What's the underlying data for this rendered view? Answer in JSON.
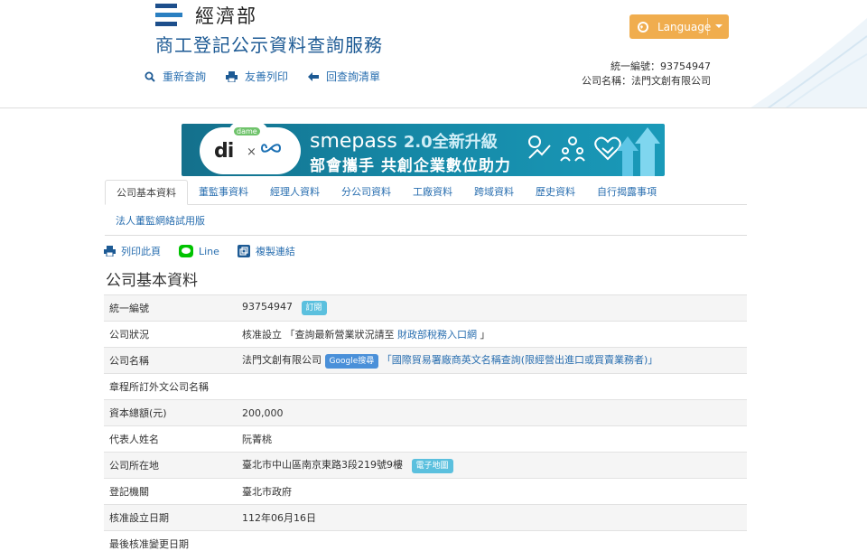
{
  "header": {
    "ministry": "經濟部",
    "service_title": "商工登記公示資料查詢服務",
    "toolbar": [
      {
        "label": "重新查詢",
        "icon": "search-icon"
      },
      {
        "label": "友善列印",
        "icon": "printer-icon"
      },
      {
        "label": "回查詢清單",
        "icon": "arrow-left-icon"
      }
    ],
    "language_label": "Language",
    "company_id_line": "統一編號：93754947",
    "company_name_line": "公司名稱：法門文創有限公司"
  },
  "banner": {
    "dame": "dame",
    "di": "di",
    "x": "×",
    "brand": "smepass",
    "version": "2.0全新升級",
    "tagline": "部會攜手 共創企業數位助力"
  },
  "tabs": {
    "row1": [
      "公司基本資料",
      "董監事資料",
      "經理人資料",
      "分公司資料",
      "工廠資料",
      "跨域資料",
      "歷史資料",
      "自行揭露事項"
    ],
    "row2": "法人董監網絡試用版",
    "active_index": 0
  },
  "actions": {
    "print": "列印此頁",
    "line": "Line",
    "copy": "複製連結"
  },
  "section_title": "公司基本資料",
  "table": {
    "rows": [
      {
        "key": "統一編號",
        "value": "93754947",
        "badge": "訂閱"
      },
      {
        "key": "公司狀況",
        "value": "核准設立 「查詢最新營業狀況請至 ",
        "link": "財政部稅務入口網",
        "suffix": " 」"
      },
      {
        "key": "公司名稱",
        "value": "法門文創有限公司",
        "badge": "Google搜尋",
        "link": "「國際貿易署廠商英文名稱查詢(限經營出進口或買賣業務者)」"
      },
      {
        "key": "章程所訂外文公司名稱",
        "value": ""
      },
      {
        "key": "資本總額(元)",
        "value": "200,000"
      },
      {
        "key": "代表人姓名",
        "value": "阮菁桃"
      },
      {
        "key": "公司所在地",
        "value": "臺北市中山區南京東路3段219號9樓",
        "badge": "電子地圖"
      },
      {
        "key": "登記機關",
        "value": "臺北市政府"
      },
      {
        "key": "核准設立日期",
        "value": "112年06月16日"
      },
      {
        "key": "最後核准變更日期",
        "value": ""
      }
    ]
  },
  "colors": {
    "accent_blue": "#2a6fb0",
    "title_blue": "#1d5a94",
    "language_orange": "#f0ad4e",
    "badge_cyan": "#5bc0de",
    "line_green": "#00c300"
  }
}
